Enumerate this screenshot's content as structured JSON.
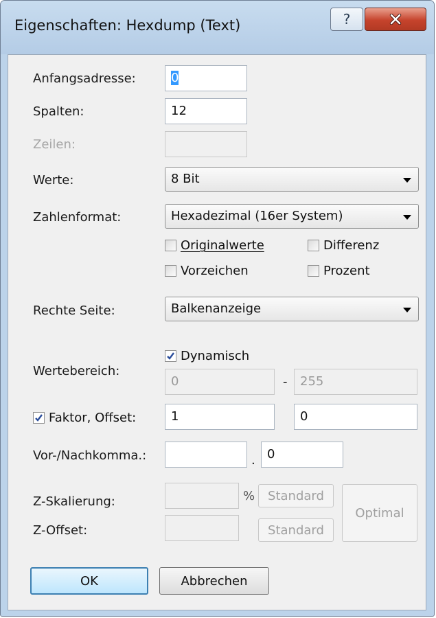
{
  "window": {
    "title": "Eigenschaften: Hexdump (Text)"
  },
  "form": {
    "start_address": {
      "label": "Anfangsadresse:",
      "value": "0"
    },
    "columns": {
      "label": "Spalten:",
      "value": "12"
    },
    "rows": {
      "label": "Zeilen:",
      "value": ""
    },
    "values": {
      "label": "Werte:",
      "selected": "8 Bit"
    },
    "number_format": {
      "label": "Zahlenformat:",
      "selected": "Hexadezimal  (16er System)"
    },
    "options": {
      "originalwerte": {
        "label": "Originalwerte",
        "checked": false
      },
      "differenz": {
        "label": "Differenz",
        "checked": false
      },
      "vorzeichen": {
        "label": "Vorzeichen",
        "checked": false
      },
      "prozent": {
        "label": "Prozent",
        "checked": false
      }
    },
    "right_side": {
      "label": "Rechte Seite:",
      "selected": "Balkenanzeige"
    },
    "value_range": {
      "label": "Wertebereich:",
      "dynamic_label": "Dynamisch",
      "dynamic_checked": true,
      "min": "0",
      "dash": "-",
      "max": "255"
    },
    "factor_offset": {
      "label": "Faktor, Offset:",
      "checked": true,
      "factor": "1",
      "offset": "0"
    },
    "decimals": {
      "label": "Vor-/Nachkomma.:",
      "before": "",
      "dot": ".",
      "after": "0"
    },
    "z_scaling": {
      "label": "Z-Skalierung:",
      "value": "",
      "unit": "%",
      "standard_label": "Standard"
    },
    "z_offset": {
      "label": "Z-Offset:",
      "value": "",
      "standard_label": "Standard"
    },
    "optimal_label": "Optimal"
  },
  "buttons": {
    "ok": "OK",
    "cancel": "Abbrechen"
  }
}
